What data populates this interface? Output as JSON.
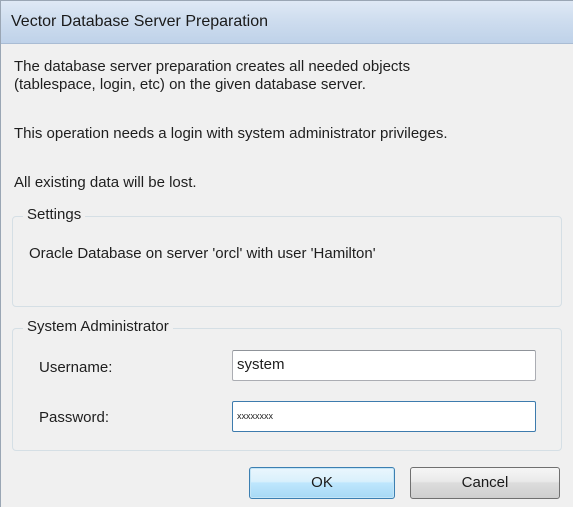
{
  "window": {
    "title": "Vector Database Server Preparation"
  },
  "message": {
    "line1": "The database server preparation creates all needed objects",
    "line2": "(tablespace, login, etc) on the given database server.",
    "line3": "This operation needs a login with system administrator privileges.",
    "line4": "All existing data will be lost."
  },
  "settings": {
    "legend": "Settings",
    "description": "Oracle Database on server 'orcl' with user 'Hamilton'"
  },
  "admin": {
    "legend": "System Administrator",
    "username_label": "Username:",
    "username_value": "system",
    "password_label": "Password:",
    "password_value": "xxxxxxxx"
  },
  "buttons": {
    "ok_label": "OK",
    "cancel_label": "Cancel"
  }
}
